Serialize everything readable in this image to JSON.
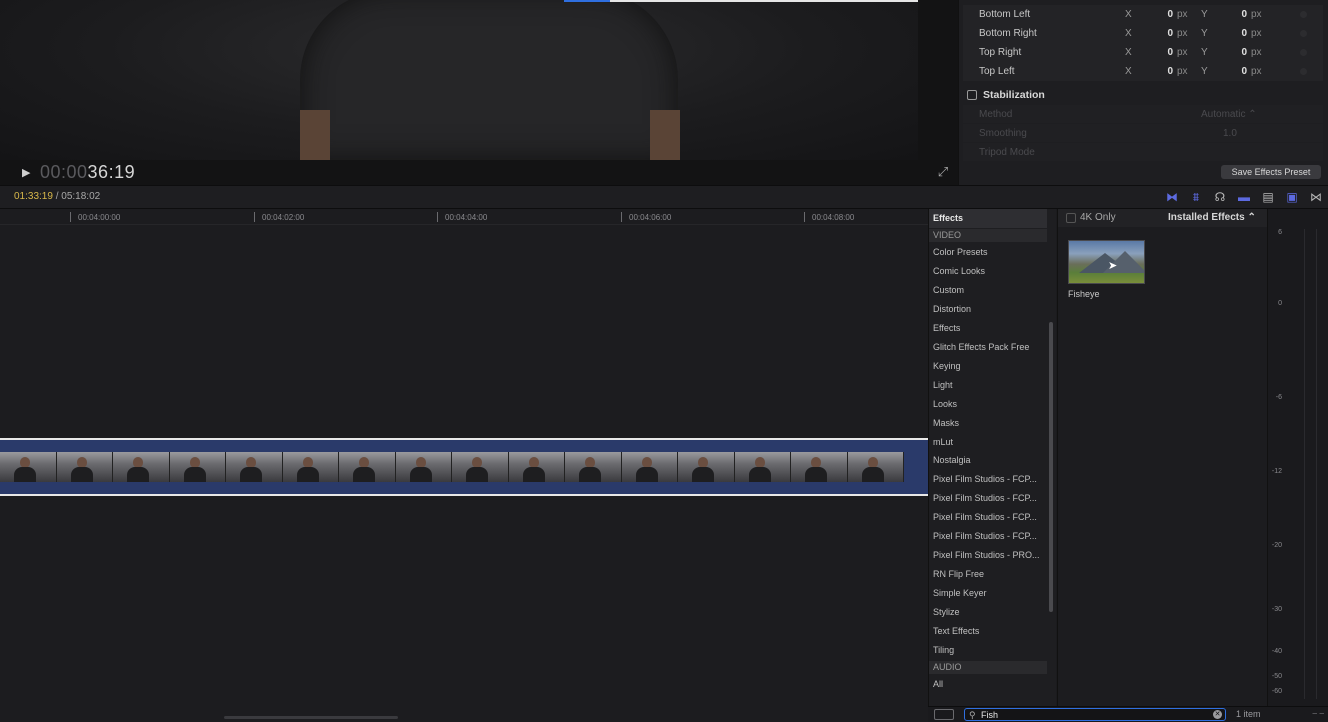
{
  "viewer": {
    "play_glyph": "▶",
    "timecode_dim": "00:00",
    "timecode_bright": "36:19",
    "fullscreen_glyph": "⤢"
  },
  "inspector": {
    "rows": [
      {
        "label": "Bottom Left",
        "x_label": "X",
        "x_value": "0",
        "x_unit": "px",
        "y_label": "Y",
        "y_value": "0",
        "y_unit": "px"
      },
      {
        "label": "Bottom Right",
        "x_label": "X",
        "x_value": "0",
        "x_unit": "px",
        "y_label": "Y",
        "y_value": "0",
        "y_unit": "px"
      },
      {
        "label": "Top Right",
        "x_label": "X",
        "x_value": "0",
        "x_unit": "px",
        "y_label": "Y",
        "y_value": "0",
        "y_unit": "px"
      },
      {
        "label": "Top Left",
        "x_label": "X",
        "x_value": "0",
        "x_unit": "px",
        "y_label": "Y",
        "y_value": "0",
        "y_unit": "px"
      }
    ],
    "stabilization_label": "Stabilization",
    "method_label": "Method",
    "method_value": "Automatic ⌃",
    "smoothing_label": "Smoothing",
    "smoothing_value": "1.0",
    "tripod_label": "Tripod Mode",
    "save_preset_label": "Save Effects Preset"
  },
  "timeline": {
    "current_time": "01:33:19",
    "total_time": "/ 05:18:02",
    "ruler_labels": [
      "00:04:00:00",
      "00:04:02:00",
      "00:04:04:00",
      "00:04:06:00",
      "00:04:08:00"
    ],
    "frame_count": 16
  },
  "effects": {
    "header": "Effects",
    "video_section": "VIDEO",
    "video_items": [
      "Color Presets",
      "Comic Looks",
      "Custom",
      "Distortion",
      "Effects",
      "Glitch Effects Pack Free",
      "Keying",
      "Light",
      "Looks",
      "Masks",
      "mLut",
      "Nostalgia",
      "Pixel Film Studios - FCP...",
      "Pixel Film Studios - FCP...",
      "Pixel Film Studios - FCP...",
      "Pixel Film Studios - FCP...",
      "Pixel Film Studios - PRO...",
      "RN Flip Free",
      "Simple Keyer",
      "Stylize",
      "Text Effects",
      "Tiling"
    ],
    "audio_section": "AUDIO",
    "audio_items": [
      "All"
    ],
    "four_k_label": "4K Only",
    "installed_label": "Installed Effects ⌃",
    "result_label": "Fisheye",
    "search_value": "Fish",
    "result_count": "1 item"
  },
  "meter": {
    "labels": [
      "6",
      "0",
      "-6",
      "-12",
      "-20",
      "-30",
      "-40",
      "-50",
      "-60"
    ]
  },
  "colors": {
    "accent_blue": "#2f6fe0",
    "timecode_yellow": "#d8b84a",
    "clip_blue": "#2a3a6a"
  }
}
